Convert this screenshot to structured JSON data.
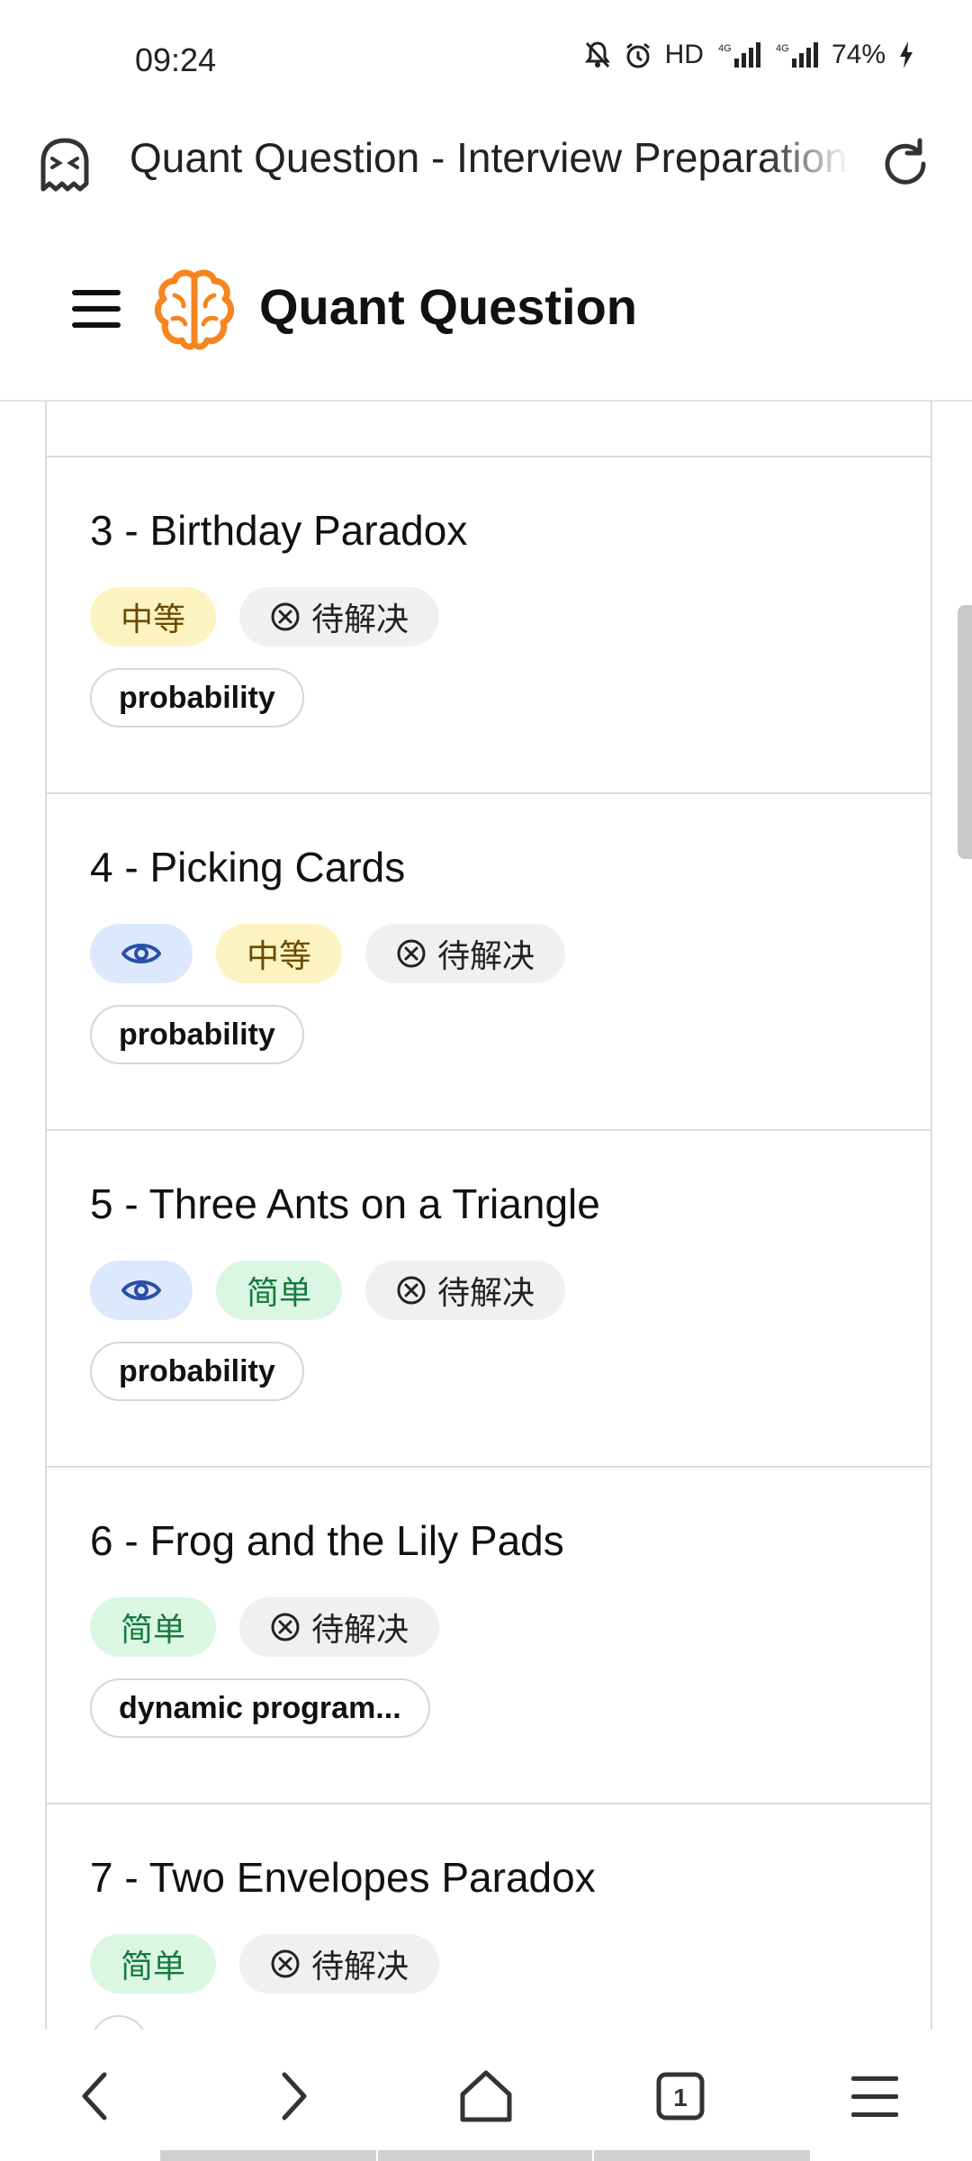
{
  "status_bar": {
    "time": "09:24",
    "network": "HD",
    "battery": "74%"
  },
  "browser": {
    "tab_title": "Quant Question - Interview Preparation"
  },
  "site": {
    "brand": "Quant Question"
  },
  "questions": [
    {
      "title": "3 - Birthday Paradox",
      "viewed": false,
      "difficulty": "中等",
      "difficulty_level": "medium",
      "status": "待解决",
      "topic": "probability"
    },
    {
      "title": "4 - Picking Cards",
      "viewed": true,
      "difficulty": "中等",
      "difficulty_level": "medium",
      "status": "待解决",
      "topic": "probability"
    },
    {
      "title": "5 - Three Ants on a Triangle",
      "viewed": true,
      "difficulty": "简单",
      "difficulty_level": "easy",
      "status": "待解决",
      "topic": "probability"
    },
    {
      "title": "6 - Frog and the Lily Pads",
      "viewed": false,
      "difficulty": "简单",
      "difficulty_level": "easy",
      "status": "待解决",
      "topic": "dynamic program..."
    },
    {
      "title": "7 - Two Envelopes Paradox",
      "viewed": false,
      "difficulty": "简单",
      "difficulty_level": "easy",
      "status": "待解决",
      "topic": ""
    }
  ],
  "bottom_nav": {
    "tab_count": "1"
  },
  "colors": {
    "brand_orange": "#f5851f",
    "eye_blue": "#2b4fa8",
    "medium_bg": "#fcf3c0",
    "easy_bg": "#dcf6e4"
  }
}
